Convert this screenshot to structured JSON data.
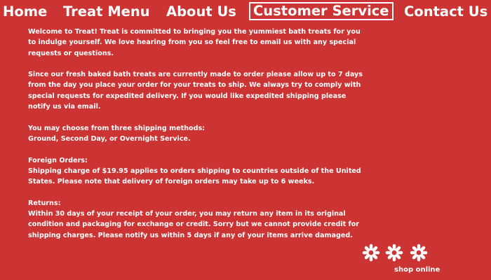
{
  "nav": {
    "home": "Home",
    "treat_menu": "Treat Menu",
    "about_us": "About Us",
    "customer_service": "Customer Service",
    "contact_us": "Contact Us"
  },
  "content": {
    "welcome_lines": [
      "Welcome to Treat! Treat is committed to bringing you the yummiest bath treats for you",
      "to indulge yourself. We love hearing from you so feel free to email us with any special",
      "requests or questions."
    ],
    "baked_lines": [
      "Since our fresh baked bath treats are currently made to order please allow up to 7 days",
      "from the day you place your order for your treats to ship. We always try to comply with",
      "special requests for expedited delivery. If you would like expedited shipping please",
      "notify us via email."
    ],
    "shipping_lines": [
      "You may choose from three shipping methods:",
      "Ground, Second Day, or Overnight Service."
    ],
    "foreign_lines": [
      "Foreign Orders:",
      "Shipping charge of $19.95 applies to orders shipping to countries outside of the United",
      "States. Please note that delivery of foreign orders may take up to 6 weeks."
    ],
    "returns_lines": [
      "Returns:",
      "Within 30 days of your receipt of your order, you may return any item in its original",
      "condition and packaging for exchange or credit. Sorry but we cannot provide credit for",
      "shipping charges. Please notify us within 5 days if any of your items arrive damaged."
    ]
  },
  "footer": {
    "shop_online": "shop online",
    "star_icon": "flower-star-icon"
  },
  "colors": {
    "background": "#CC3333",
    "text": "#FFFFFF"
  }
}
